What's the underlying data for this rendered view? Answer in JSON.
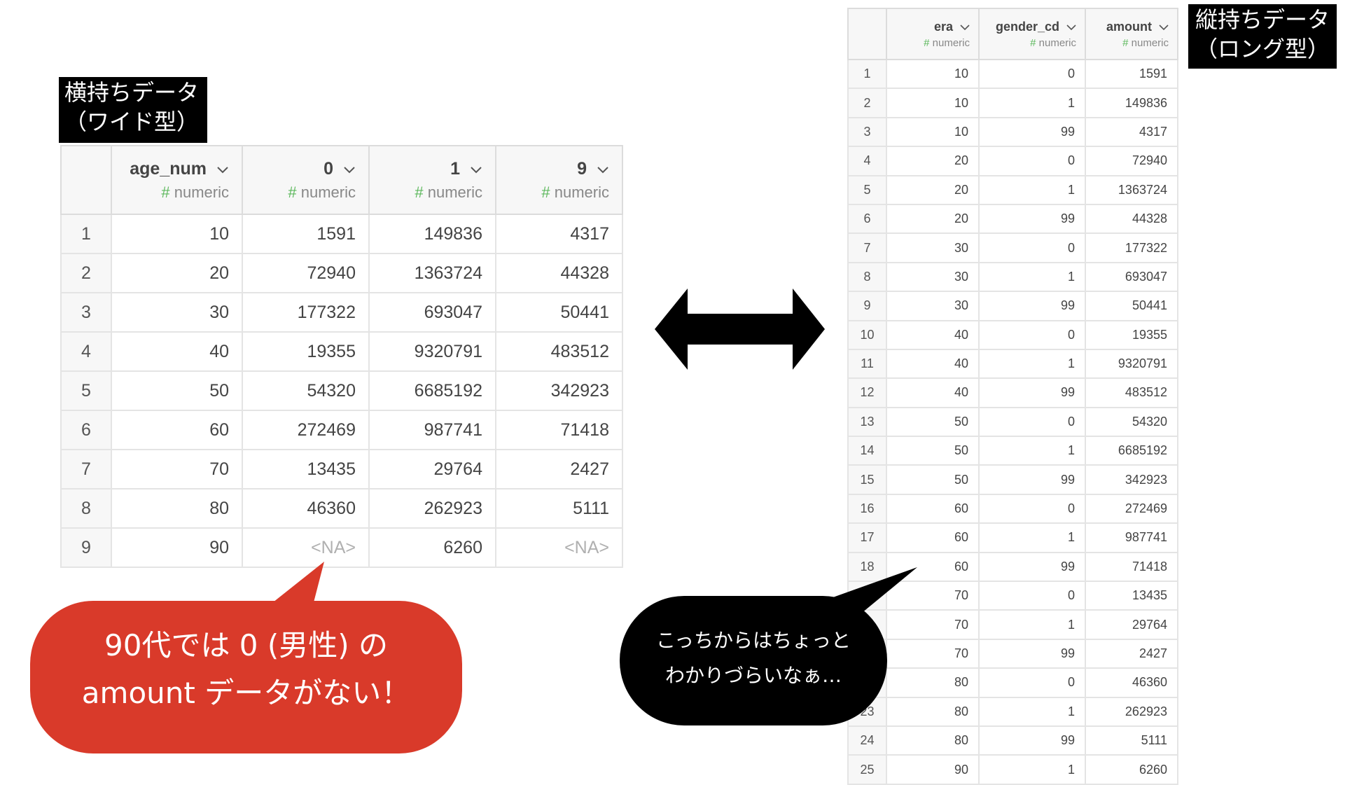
{
  "labels": {
    "wide_line1": "横持ちデータ",
    "wide_line2": "（ワイド型）",
    "long_line1": "縦持ちデータ",
    "long_line2": "（ロング型）"
  },
  "wide_table": {
    "columns": [
      {
        "name": "age_num",
        "type": "numeric"
      },
      {
        "name": "0",
        "type": "numeric"
      },
      {
        "name": "1",
        "type": "numeric"
      },
      {
        "name": "9",
        "type": "numeric"
      }
    ],
    "type_prefix": "#",
    "rows": [
      [
        "1",
        "10",
        "1591",
        "149836",
        "4317"
      ],
      [
        "2",
        "20",
        "72940",
        "1363724",
        "44328"
      ],
      [
        "3",
        "30",
        "177322",
        "693047",
        "50441"
      ],
      [
        "4",
        "40",
        "19355",
        "9320791",
        "483512"
      ],
      [
        "5",
        "50",
        "54320",
        "6685192",
        "342923"
      ],
      [
        "6",
        "60",
        "272469",
        "987741",
        "71418"
      ],
      [
        "7",
        "70",
        "13435",
        "29764",
        "2427"
      ],
      [
        "8",
        "80",
        "46360",
        "262923",
        "5111"
      ],
      [
        "9",
        "90",
        "<NA>",
        "6260",
        "<NA>"
      ]
    ]
  },
  "long_table": {
    "columns": [
      {
        "name": "era",
        "type": "numeric"
      },
      {
        "name": "gender_cd",
        "type": "numeric"
      },
      {
        "name": "amount",
        "type": "numeric"
      }
    ],
    "type_prefix": "#",
    "rows": [
      [
        "1",
        "10",
        "0",
        "1591"
      ],
      [
        "2",
        "10",
        "1",
        "149836"
      ],
      [
        "3",
        "10",
        "99",
        "4317"
      ],
      [
        "4",
        "20",
        "0",
        "72940"
      ],
      [
        "5",
        "20",
        "1",
        "1363724"
      ],
      [
        "6",
        "20",
        "99",
        "44328"
      ],
      [
        "7",
        "30",
        "0",
        "177322"
      ],
      [
        "8",
        "30",
        "1",
        "693047"
      ],
      [
        "9",
        "30",
        "99",
        "50441"
      ],
      [
        "10",
        "40",
        "0",
        "19355"
      ],
      [
        "11",
        "40",
        "1",
        "9320791"
      ],
      [
        "12",
        "40",
        "99",
        "483512"
      ],
      [
        "13",
        "50",
        "0",
        "54320"
      ],
      [
        "14",
        "50",
        "1",
        "6685192"
      ],
      [
        "15",
        "50",
        "99",
        "342923"
      ],
      [
        "16",
        "60",
        "0",
        "272469"
      ],
      [
        "17",
        "60",
        "1",
        "987741"
      ],
      [
        "18",
        "60",
        "99",
        "71418"
      ],
      [
        "",
        "70",
        "0",
        "13435"
      ],
      [
        "",
        "70",
        "1",
        "29764"
      ],
      [
        "",
        "70",
        "99",
        "2427"
      ],
      [
        "",
        "80",
        "0",
        "46360"
      ],
      [
        "23",
        "80",
        "1",
        "262923"
      ],
      [
        "24",
        "80",
        "99",
        "5111"
      ],
      [
        "25",
        "90",
        "1",
        "6260"
      ]
    ]
  },
  "callouts": {
    "red_line1": "90代では 0 (男性) の",
    "red_line2": "amount データがない！",
    "black_line1": "こっちからはちょっと",
    "black_line2": "わかりづらいなぁ…"
  },
  "icons": {
    "column_menu": "chevron-down-icon",
    "arrow": "double-headed-arrow-icon"
  },
  "colors": {
    "red_bubble": "#d93a2a",
    "black_bubble": "#000000",
    "type_hash": "#5cb85c",
    "na_text": "#b0b0b0"
  }
}
